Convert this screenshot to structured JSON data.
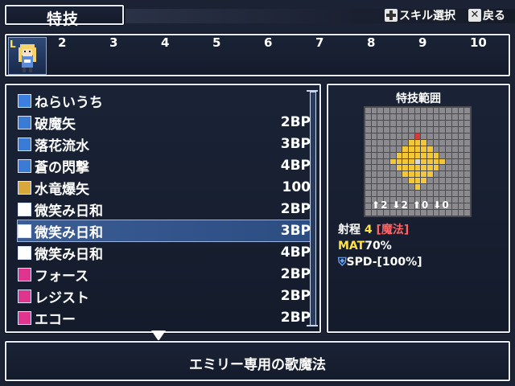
{
  "title": "特技",
  "hints": {
    "skill_select": "スキル選択",
    "back": "戻る"
  },
  "party": {
    "level_badge": "L",
    "slots": [
      "2",
      "3",
      "4",
      "5",
      "6",
      "7",
      "8",
      "9",
      "10"
    ]
  },
  "skills": [
    {
      "icon": "wand-icon",
      "name": "ねらいうち",
      "cost": ""
    },
    {
      "icon": "magic-square-icon",
      "name": "破魔矢",
      "cost": "2BP"
    },
    {
      "icon": "magic-square-icon",
      "name": "落花流水",
      "cost": "3BP"
    },
    {
      "icon": "magic-square-icon",
      "name": "蒼の閃撃",
      "cost": "4BP"
    },
    {
      "icon": "gold-dots-icon",
      "name": "水竜爆矢",
      "cost": "100"
    },
    {
      "icon": "music-note-icon",
      "name": "微笑み日和",
      "cost": "2BP"
    },
    {
      "icon": "music-note-plus-icon",
      "name": "微笑み日和",
      "cost": "3BP"
    },
    {
      "icon": "music-note-plus2-icon",
      "name": "微笑み日和",
      "cost": "4BP"
    },
    {
      "icon": "vo-icon",
      "name": "フォース",
      "cost": "2BP"
    },
    {
      "icon": "vo-icon",
      "name": "レジスト",
      "cost": "2BP"
    },
    {
      "icon": "vo-icon",
      "name": "エコー",
      "cost": "2BP"
    }
  ],
  "selected_index": 6,
  "range": {
    "title": "特技範囲",
    "stats": [
      "2",
      "2",
      "0",
      "0"
    ],
    "range_label": "射程",
    "range_value": "4",
    "range_type": "[魔法]",
    "mat_label": "MAT",
    "mat_value": "70%",
    "spd_text": "SPD-[100%]"
  },
  "description": "エミリー専用の歌魔法",
  "colors": {
    "accent_yellow": "#ffe24a",
    "accent_red": "#ff6262",
    "selection": "#3a5d94"
  }
}
